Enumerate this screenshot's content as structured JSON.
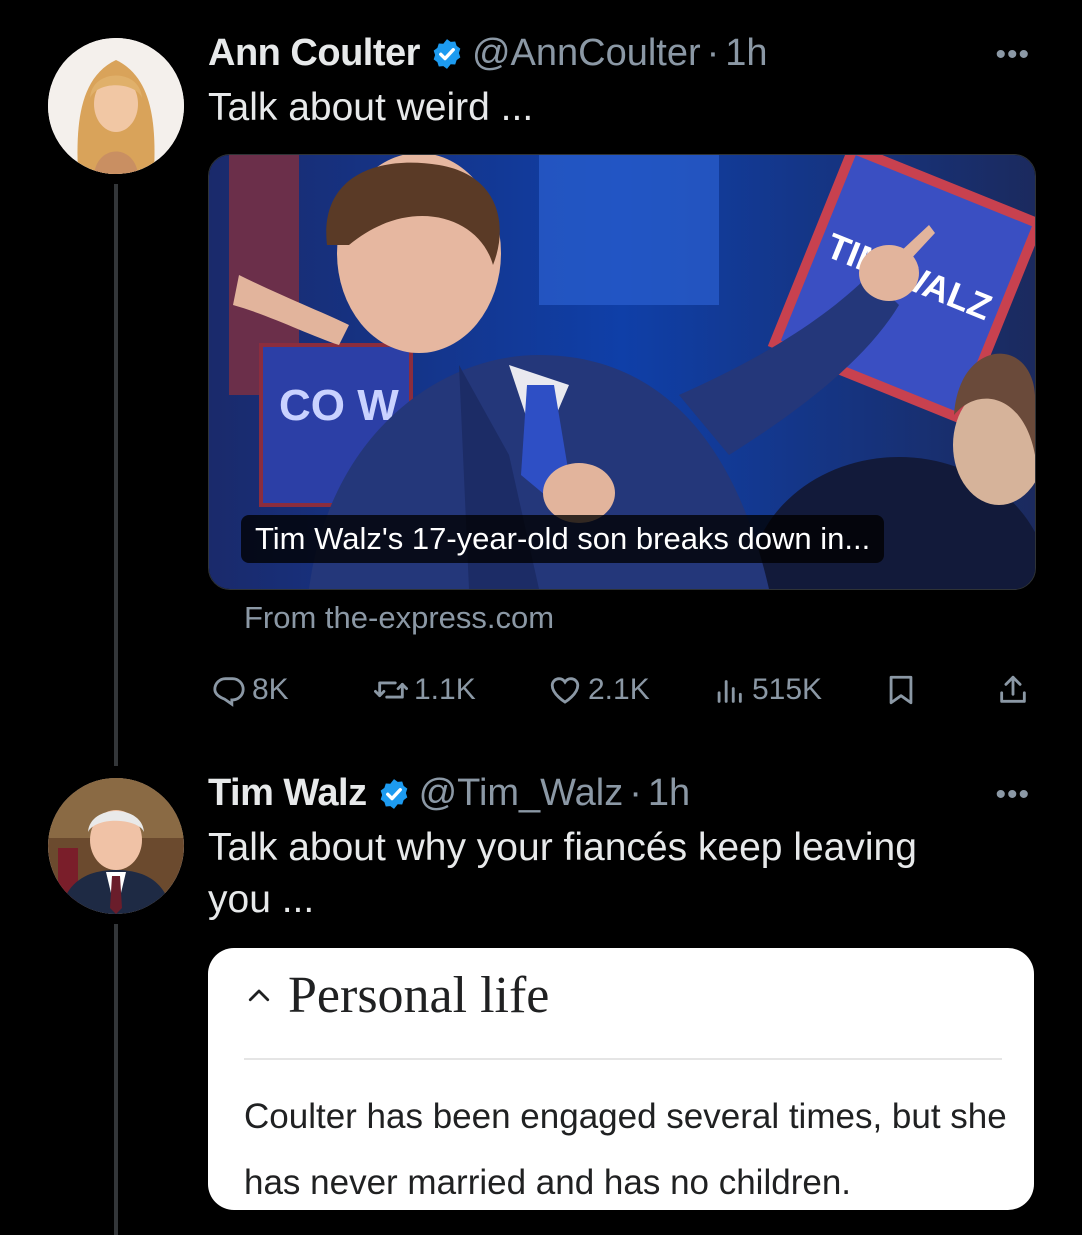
{
  "tweet1": {
    "author_name": "Ann Coulter",
    "handle": "@AnnCoulter",
    "separator": "·",
    "time": "1h",
    "text": "Talk about weird ...",
    "media_caption": "Tim Walz's 17-year-old son breaks down in...",
    "media_sign_left": "CO W",
    "media_sign_right": "TIM WALZ",
    "source": "From the-express.com",
    "stats": {
      "replies": "8K",
      "reposts": "1.1K",
      "likes": "2.1K",
      "views": "515K"
    }
  },
  "tweet2": {
    "author_name": "Tim Walz",
    "handle": "@Tim_Walz",
    "separator": "·",
    "time": "1h",
    "text_line1": "Talk about why your fiancés keep leaving",
    "text_line2": "you ..."
  },
  "wiki_card": {
    "title": "Personal life",
    "body": "Coulter has been engaged several times, but she has never married and has no children."
  },
  "colors": {
    "background": "#000000",
    "text": "#e7e9ea",
    "secondary": "#8b98a5",
    "verified": "#1d9bf0",
    "card_background": "#ffffff"
  },
  "icons": {
    "verified": "verified-badge-icon",
    "more": "more-icon",
    "reply": "reply-icon",
    "repost": "repost-icon",
    "like": "heart-icon",
    "views": "views-icon",
    "bookmark": "bookmark-icon",
    "share": "share-icon",
    "collapse": "chevron-up-icon"
  }
}
